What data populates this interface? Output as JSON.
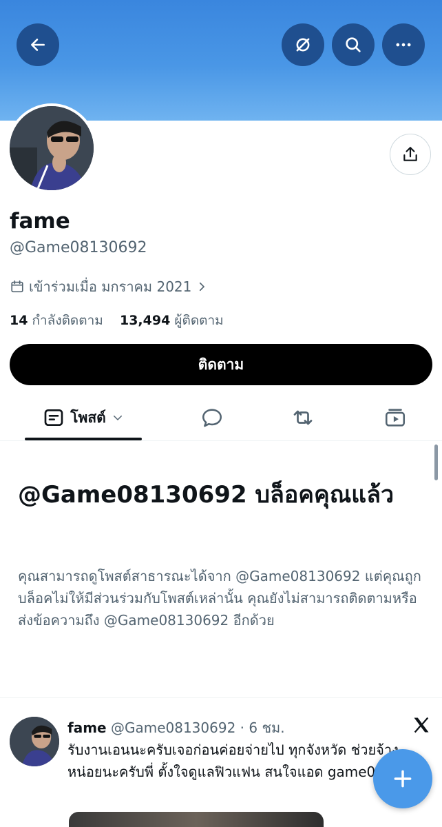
{
  "profile": {
    "name": "fame",
    "handle": "@Game08130692",
    "joined": "เข้าร่วมเมื่อ มกราคม 2021",
    "following_count": "14",
    "following_label": "กำลังติดตาม",
    "followers_count": "13,494",
    "followers_label": "ผู้ติดตาม"
  },
  "actions": {
    "follow_label": "ติดตาม"
  },
  "tabs": {
    "posts_label": "โพสต์"
  },
  "blocked": {
    "title": "@Game08130692 บล็อคคุณแล้ว",
    "body": "คุณสามารถดูโพสต์สาธารณะได้จาก @Game08130692 แต่คุณถูกบล็อคไม่ให้มีส่วนร่วมกับโพสต์เหล่านั้น คุณยังไม่สามารถติดตามหรือส่งข้อความถึง @Game08130692 อีกด้วย"
  },
  "tweet": {
    "name": "fame",
    "handle": "@Game08130692",
    "time": "· 6 ชม.",
    "text": "รับงานเอนนะครับเจอก่อนค่อยจ่ายไป ทุกจังหวัด ช่วยจ้างหน่อยนะครับพี่ ตั้งใจดูแลฟิวแฟน สนใจแอด game081041"
  },
  "icons": {
    "back": "arrow-left-icon",
    "grok": "grok-icon",
    "search": "search-icon",
    "more": "more-icon",
    "share": "share-icon",
    "calendar": "calendar-icon",
    "posts": "posts-icon",
    "replies": "reply-icon",
    "reposts": "repost-icon",
    "media": "media-icon",
    "x_logo": "x-logo-icon",
    "compose": "plus-icon"
  },
  "colors": {
    "banner": "#4a97e6",
    "fab": "#4a99e9",
    "follow_button": "#000000"
  }
}
